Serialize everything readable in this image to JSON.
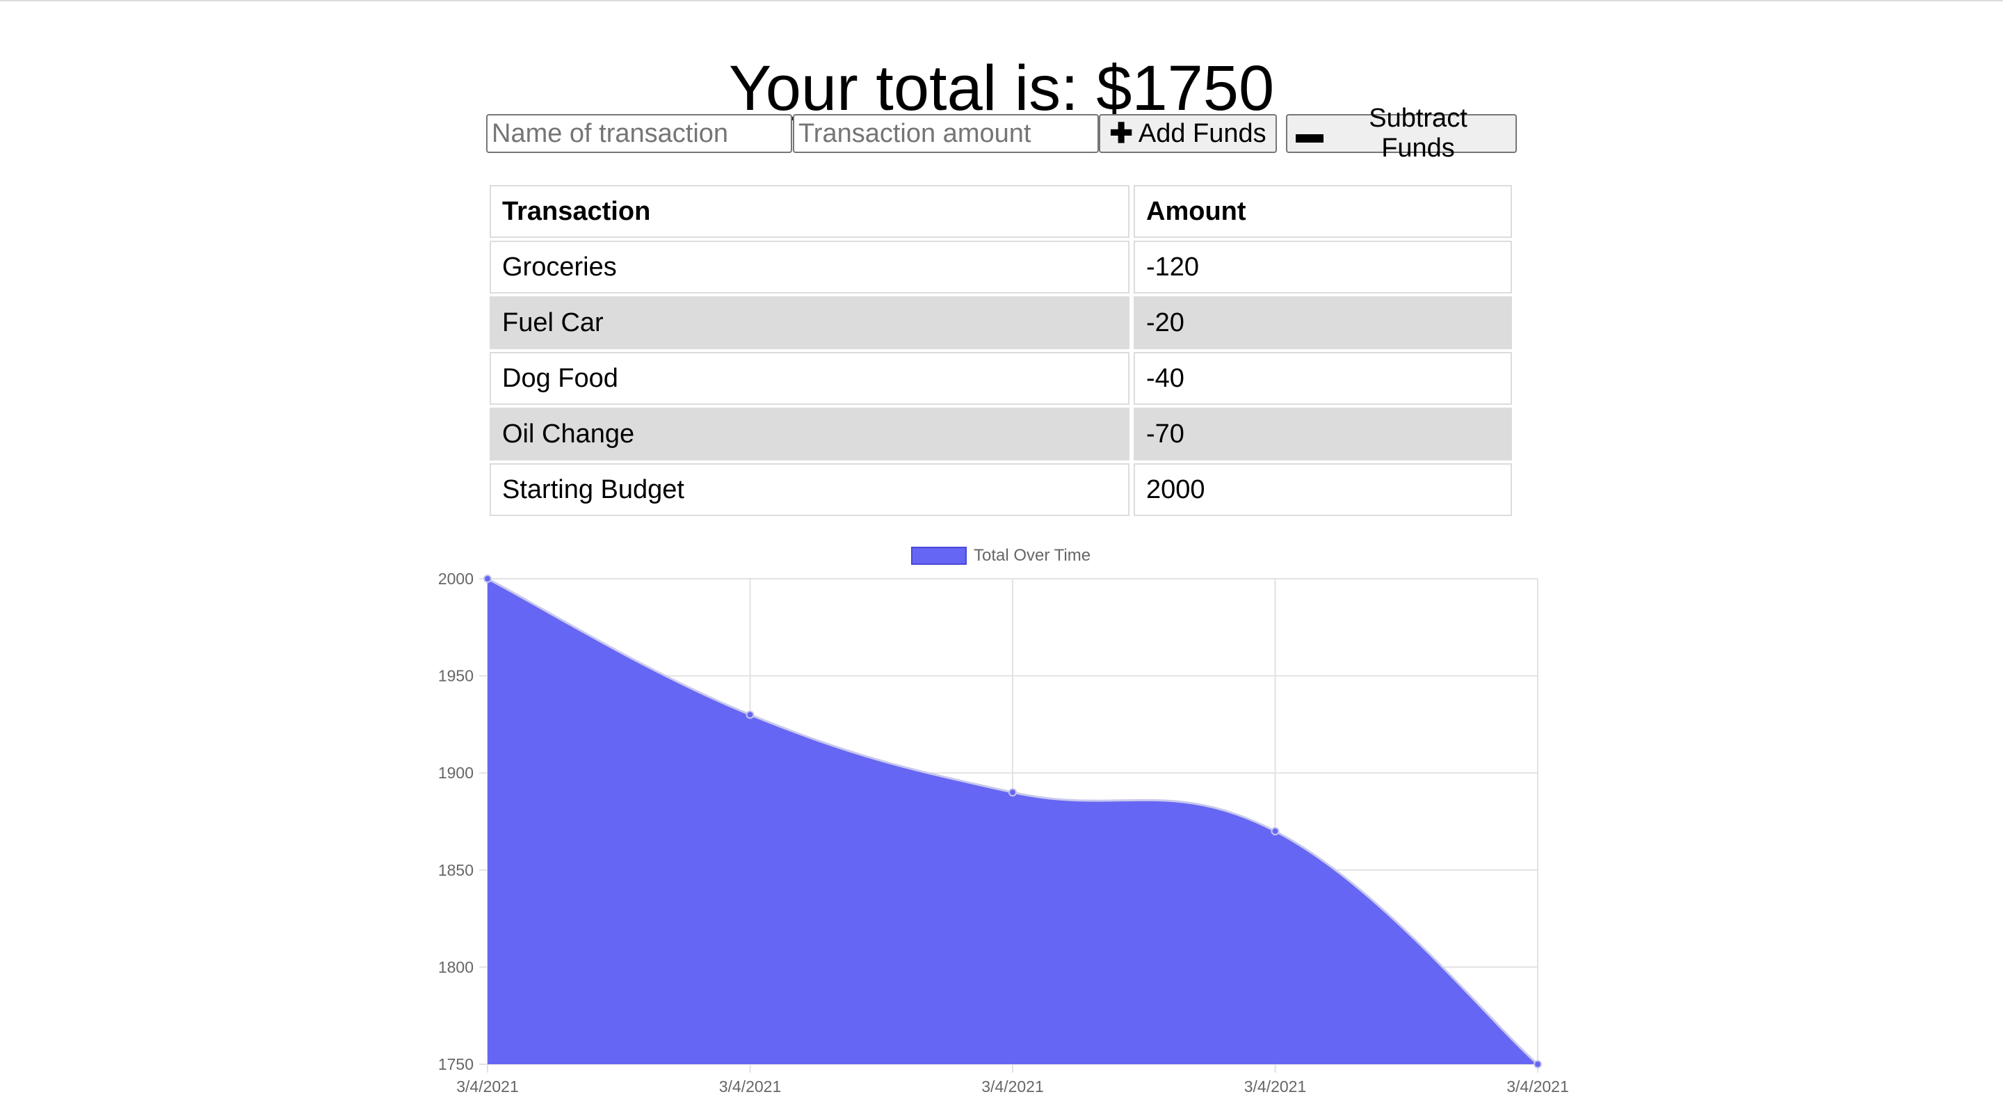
{
  "header": {
    "total_text": "Your total is: $1750"
  },
  "form": {
    "name_placeholder": "Name of transaction",
    "amount_placeholder": "Transaction amount",
    "add_label": "Add Funds",
    "subtract_label": "Subtract Funds",
    "add_icon": "plus-icon",
    "subtract_icon": "minus-icon"
  },
  "table": {
    "headers": [
      "Transaction",
      "Amount"
    ],
    "rows": [
      {
        "name": "Groceries",
        "amount": "-120"
      },
      {
        "name": "Fuel Car",
        "amount": "-20"
      },
      {
        "name": "Dog Food",
        "amount": "-40"
      },
      {
        "name": "Oil Change",
        "amount": "-70"
      },
      {
        "name": "Starting Budget",
        "amount": "2000"
      }
    ]
  },
  "chart_data": {
    "type": "area",
    "x": [
      "3/4/2021",
      "3/4/2021",
      "3/4/2021",
      "3/4/2021",
      "3/4/2021"
    ],
    "series": [
      {
        "name": "Total Over Time",
        "values": [
          2000,
          1930,
          1890,
          1870,
          1750
        ],
        "color": "#6666f4"
      }
    ],
    "ylim": [
      1750,
      2000
    ],
    "yticks": [
      2000,
      1950,
      1900,
      1850,
      1800,
      1750
    ],
    "grid": true,
    "legend": "top-center"
  }
}
